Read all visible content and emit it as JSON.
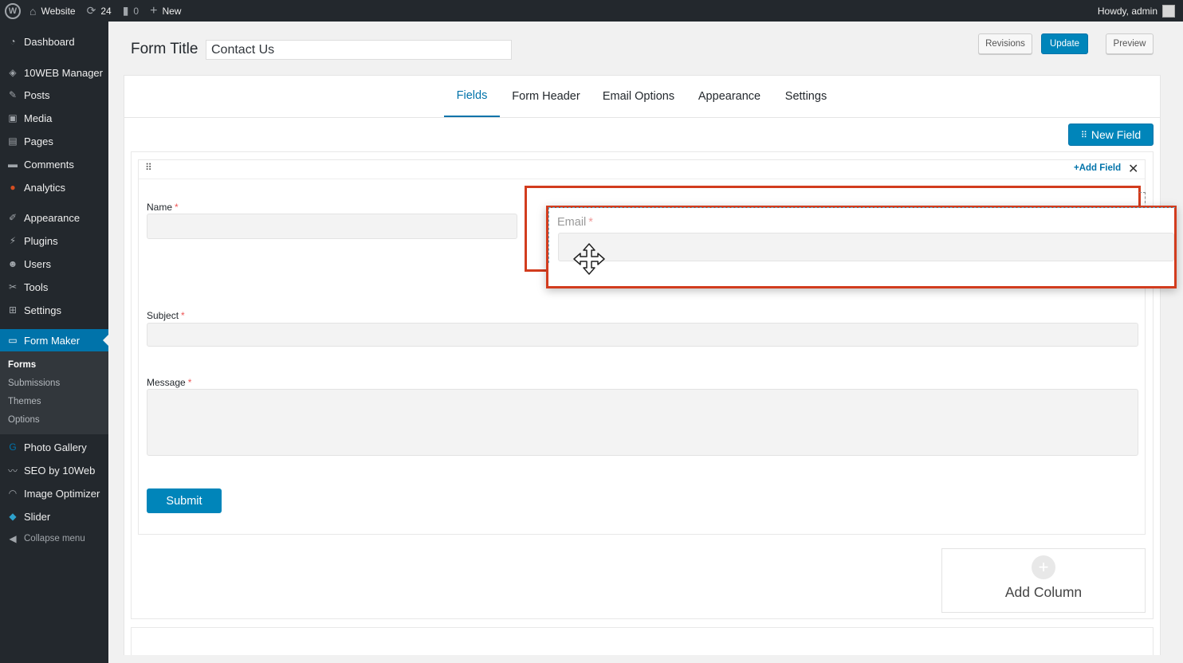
{
  "adminbar": {
    "logo": "W",
    "site": "Website",
    "updates": "24",
    "comments": "0",
    "new": "New",
    "howdy": "Howdy, admin"
  },
  "sidebar": {
    "items": [
      {
        "label": "Dashboard",
        "icon": "dashboard-icon"
      },
      {
        "label": "10WEB Manager",
        "icon": "diamond-icon"
      },
      {
        "label": "Posts",
        "icon": "pin-icon"
      },
      {
        "label": "Media",
        "icon": "media-icon"
      },
      {
        "label": "Pages",
        "icon": "pages-icon"
      },
      {
        "label": "Comments",
        "icon": "comment-icon"
      },
      {
        "label": "Analytics",
        "icon": "analytics-icon"
      },
      {
        "label": "Appearance",
        "icon": "brush-icon"
      },
      {
        "label": "Plugins",
        "icon": "plug-icon"
      },
      {
        "label": "Users",
        "icon": "user-icon"
      },
      {
        "label": "Tools",
        "icon": "wrench-icon"
      },
      {
        "label": "Settings",
        "icon": "settings-icon"
      },
      {
        "label": "Form Maker",
        "icon": "form-icon"
      },
      {
        "label": "Photo Gallery",
        "icon": "gallery-icon"
      },
      {
        "label": "SEO by 10Web",
        "icon": "seo-icon"
      },
      {
        "label": "Image Optimizer",
        "icon": "gauge-icon"
      },
      {
        "label": "Slider",
        "icon": "slider-icon"
      },
      {
        "label": "Collapse menu",
        "icon": "collapse-icon"
      }
    ],
    "submenu": [
      "Forms",
      "Submissions",
      "Themes",
      "Options"
    ]
  },
  "header": {
    "form_title_label": "Form Title",
    "form_title_value": "Contact Us",
    "revisions": "Revisions",
    "update": "Update",
    "preview": "Preview"
  },
  "tabs": [
    "Fields",
    "Form Header",
    "Email Options",
    "Appearance",
    "Settings"
  ],
  "active_tab": "Fields",
  "toolbar": {
    "new_field": "New Field",
    "add_field": "Add Field"
  },
  "fields": {
    "name": {
      "label": "Name",
      "required": "*"
    },
    "email": {
      "label": "Email",
      "required": "*"
    },
    "subject": {
      "label": "Subject",
      "required": "*"
    },
    "message": {
      "label": "Message",
      "required": "*"
    },
    "submit": "Submit"
  },
  "add_column": "Add Column",
  "colors": {
    "accent": "#0073aa",
    "button": "#0085ba",
    "highlight": "#d23c1e",
    "sidebar": "#23282d"
  }
}
